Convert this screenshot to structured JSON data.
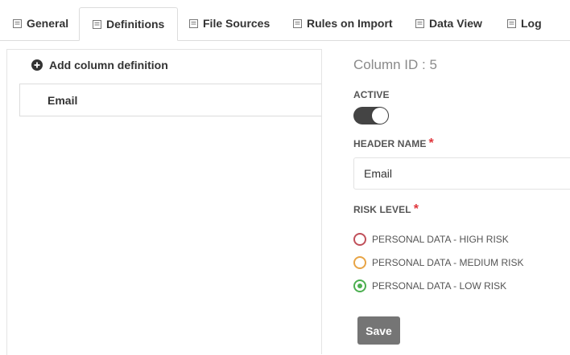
{
  "tabs": [
    {
      "label": "General",
      "icon": "form-icon"
    },
    {
      "label": "Definitions",
      "icon": "form-icon",
      "active": true
    },
    {
      "label": "File Sources",
      "icon": "form-icon"
    },
    {
      "label": "Rules on Import",
      "icon": "form-icon"
    },
    {
      "label": "Data View",
      "icon": "form-icon"
    },
    {
      "label": "Log",
      "icon": "form-icon"
    }
  ],
  "left": {
    "add_label": "Add column definition",
    "columns": [
      "Email"
    ]
  },
  "detail": {
    "column_id": "Column ID : 5",
    "active_label": "ACTIVE",
    "active": true,
    "header_name_label": "HEADER NAME",
    "required_mark": "*",
    "header_name_value": "Email",
    "risk_label": "RISK LEVEL",
    "risk_options": [
      {
        "label": "PERSONAL DATA - HIGH RISK",
        "color": "#c0505a",
        "selected": false
      },
      {
        "label": "PERSONAL DATA - MEDIUM RISK",
        "color": "#e8a445",
        "selected": false
      },
      {
        "label": "PERSONAL DATA - LOW RISK",
        "color": "#4caf50",
        "selected": true
      }
    ],
    "save_label": "Save"
  }
}
